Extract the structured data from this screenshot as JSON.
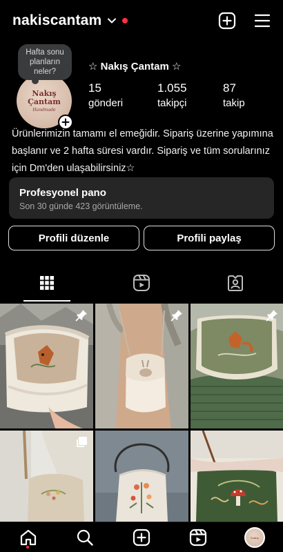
{
  "header": {
    "username": "nakiscantam",
    "has_notification": true
  },
  "profile": {
    "note": "Hafta sonu planların neler?",
    "display_name": "☆ Nakış Çantam ☆",
    "avatar_logo": {
      "line1": "Nakış",
      "line2": "Çantam",
      "line3": "Handmade"
    },
    "stats": [
      {
        "value": "15",
        "label": "gönderi"
      },
      {
        "value": "1.055",
        "label": "takipçi"
      },
      {
        "value": "87",
        "label": "takip"
      }
    ],
    "bio": "Ürünlerimizin tamamı el emeğidir. Sipariş üzerine yapımına başlanır ve 2 hafta süresi vardır. Sipariş ve tüm sorularınız için Dm'den ulaşabilirsiniz☆"
  },
  "dashboard": {
    "title": "Profesyonel pano",
    "subtitle": "Son 30 günde 423 görüntüleme."
  },
  "buttons": {
    "edit": "Profili düzenle",
    "share": "Profili paylaş"
  },
  "tabs": [
    {
      "name": "grid",
      "icon": "grid-icon",
      "active": true
    },
    {
      "name": "reels",
      "icon": "reels-icon",
      "active": false
    },
    {
      "name": "tagged",
      "icon": "tagged-icon",
      "active": false
    }
  ],
  "posts": [
    {
      "subject": "cream knit bag with fox embroidery",
      "pinned": true
    },
    {
      "subject": "teddy fleece bag with bunny embroidery",
      "pinned": true
    },
    {
      "subject": "green knit bag with fox embroidery",
      "pinned": true
    },
    {
      "subject": "beige bag with floral embroidery",
      "pinned": false,
      "multi": true
    },
    {
      "subject": "white saddle bag with coral flowers",
      "pinned": false
    },
    {
      "subject": "green bag with mushroom embroidery",
      "pinned": false
    }
  ],
  "nav": {
    "items": [
      "home-icon",
      "search-icon",
      "create-icon",
      "reels-icon",
      "profile-avatar"
    ],
    "active": "home-icon"
  },
  "colors": {
    "background": "#000000",
    "surface": "#262626",
    "accent_red": "#ff3040",
    "muted_text": "#a8a8a8"
  }
}
